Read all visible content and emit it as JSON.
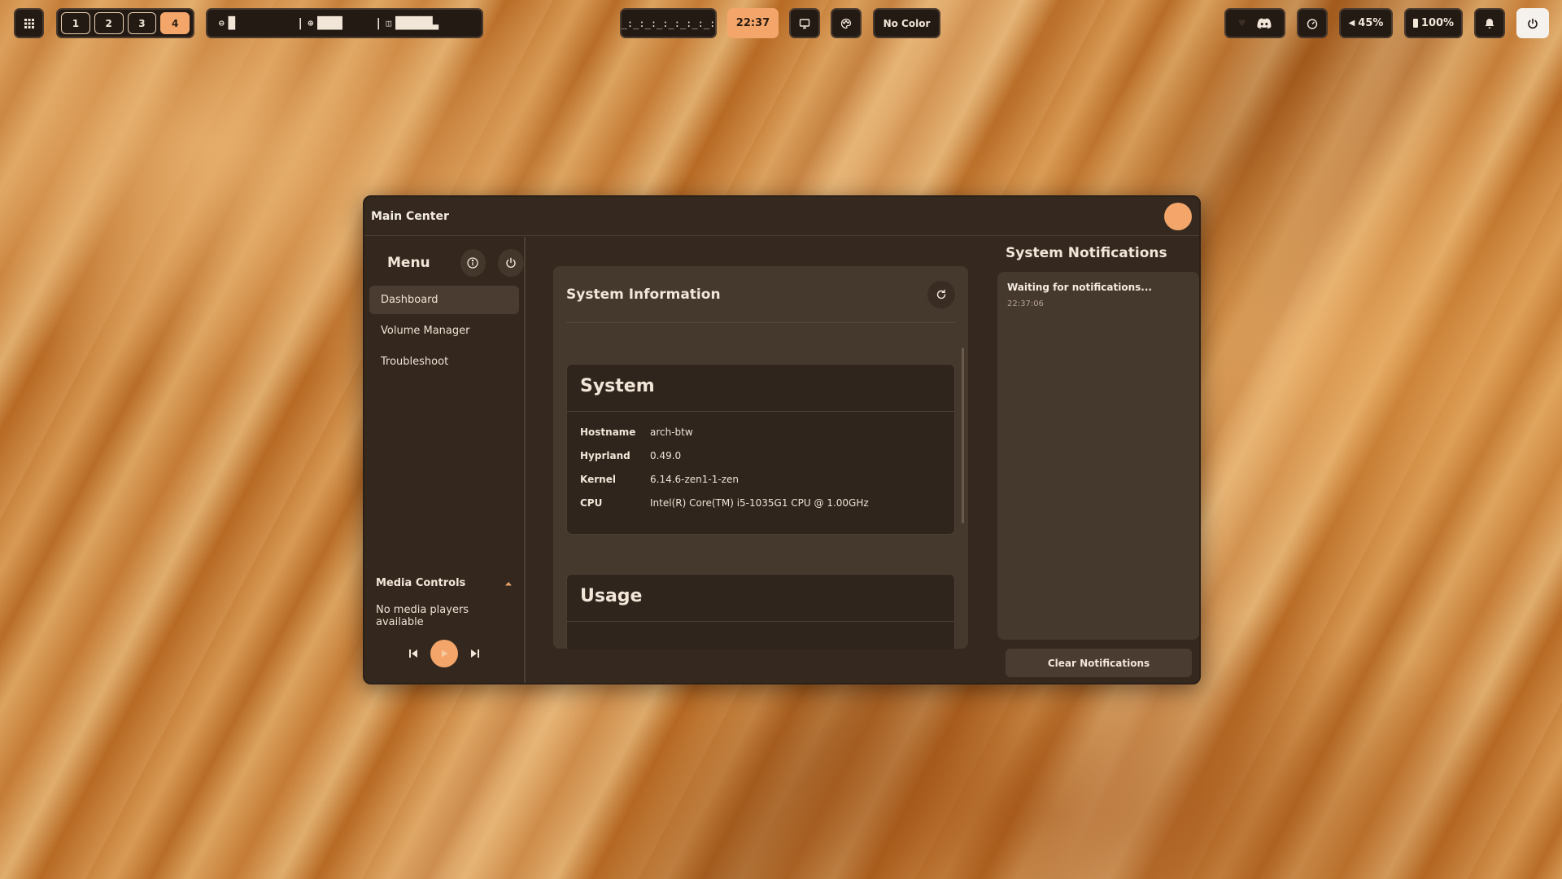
{
  "topbar": {
    "workspaces": [
      "1",
      "2",
      "3",
      "4"
    ],
    "active_workspace": "4",
    "stats": [
      {
        "icon": "cpu-icon",
        "bars": "█"
      },
      {
        "icon": "memory-icon",
        "bars": "████"
      },
      {
        "icon": "disk-icon",
        "bars": "██████▃"
      }
    ],
    "player_text": "_:_:_:_:_:_:_:_:",
    "clock": "22:37",
    "color_label": "No Color",
    "volume": "45%",
    "battery": "100%"
  },
  "window": {
    "title": "Main Center",
    "sidebar": {
      "menu_title": "Menu",
      "items": [
        {
          "label": "Dashboard",
          "active": true
        },
        {
          "label": "Volume Manager",
          "active": false
        },
        {
          "label": "Troubleshoot",
          "active": false
        }
      ],
      "media": {
        "title": "Media Controls",
        "status": "No media players available"
      }
    },
    "system_info": {
      "title": "System Information",
      "system": {
        "title": "System",
        "rows": [
          {
            "key": "Hostname",
            "value": "arch-btw"
          },
          {
            "key": "Hyprland",
            "value": "0.49.0"
          },
          {
            "key": "Kernel",
            "value": "6.14.6-zen1-1-zen"
          },
          {
            "key": "CPU",
            "value": "Intel(R) Core(TM) i5-1035G1 CPU @ 1.00GHz"
          }
        ]
      },
      "usage": {
        "title": "Usage"
      }
    },
    "notifications": {
      "title": "System Notifications",
      "items": [
        {
          "message": "Waiting for notifications...",
          "time": "22:37:06"
        }
      ],
      "clear_label": "Clear Notifications"
    }
  },
  "colors": {
    "accent": "#f4a66a",
    "panel_bg": "#35291f",
    "card_bg": "#45382d",
    "text": "#f2e6d8"
  }
}
